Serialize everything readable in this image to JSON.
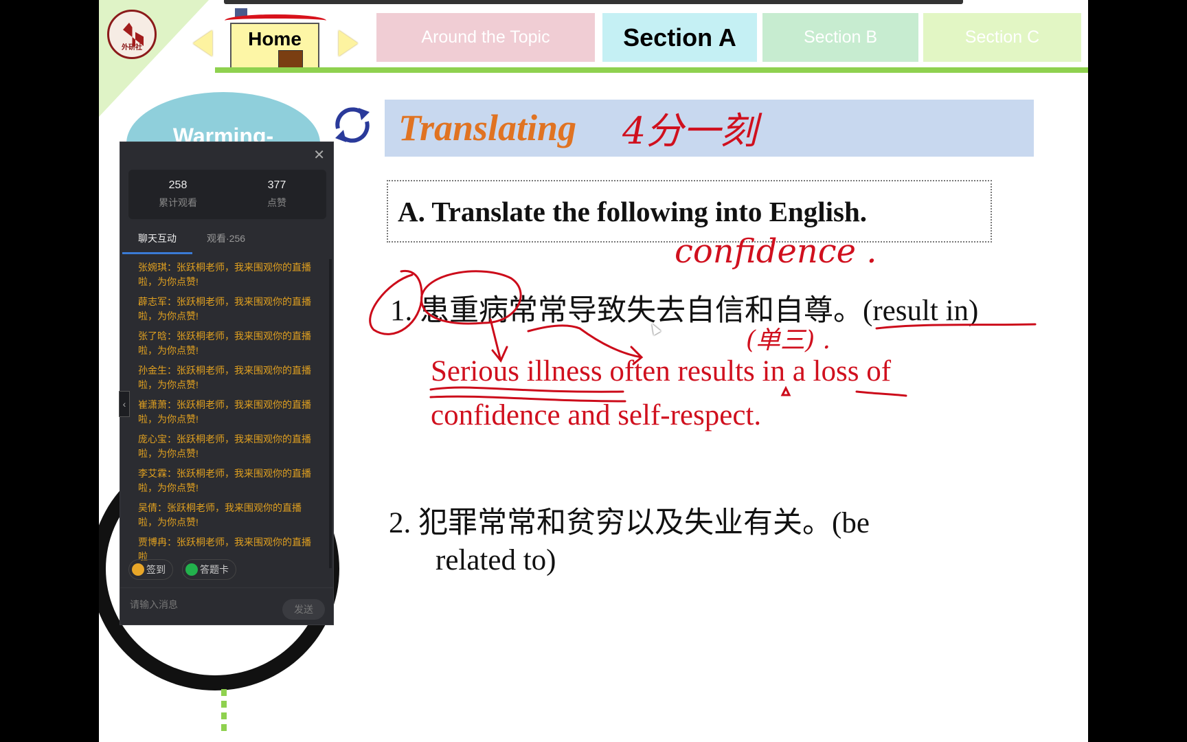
{
  "nav": {
    "logo_text": "外研社",
    "home_label": "Home",
    "tabs": [
      {
        "label": "Around the Topic",
        "bg": "#f0cdd4",
        "active": false
      },
      {
        "label": "Section A",
        "bg": "#c5f0f4",
        "active": true
      },
      {
        "label": "Section B",
        "bg": "#c7ecd0",
        "active": false
      },
      {
        "label": "Section C",
        "bg": "#e2f6c4",
        "active": false
      }
    ]
  },
  "sidebar": {
    "warming_label": "Warming-"
  },
  "slide": {
    "title": "Translating",
    "instruction": "A. Translate the following into English.",
    "items": [
      {
        "number": "1.",
        "chinese": "患重病常常导致失去自信和自尊。",
        "hint": "(result in)",
        "answer_line1": "Serious illness often results in a loss of",
        "answer_line2": "confidence and self-respect."
      },
      {
        "number": "2.",
        "chinese": "犯罪常常和贫穷以及失业有关。",
        "hint_line1": "(be",
        "hint_line2": "related to)"
      }
    ],
    "handwriting": {
      "title_note": "4分一刻",
      "confidence": "confidence .",
      "note": "(单三) ."
    }
  },
  "chat": {
    "stats": [
      {
        "value": "258",
        "label": "累计观看"
      },
      {
        "value": "377",
        "label": "点赞"
      }
    ],
    "tabs": {
      "chat": "聊天互动",
      "viewers": "观看·256"
    },
    "messages": [
      "张婉琪：张跃桐老师，我来围观你的直播啦，为你点赞!",
      "薜志军：张跃桐老师，我来围观你的直播啦，为你点赞!",
      "张了晗：张跃桐老师，我来围观你的直播啦，为你点赞!",
      "孙金生：张跃桐老师，我来围观你的直播啦，为你点赞!",
      "崔潇萧：张跃桐老师，我来围观你的直播啦，为你点赞!",
      "庞心宝：张跃桐老师，我来围观你的直播啦，为你点赞!",
      "李艾霖：张跃桐老师，我来围观你的直播啦，为你点赞!",
      "吴倩：张跃桐老师，我来围观你的直播啦，为你点赞!",
      "贾博冉：张跃桐老师，我来围观你的直播啦"
    ],
    "checkin_label": "签到",
    "answer_card_label": "答题卡",
    "input_placeholder": "请输入消息",
    "send_label": "发送"
  }
}
